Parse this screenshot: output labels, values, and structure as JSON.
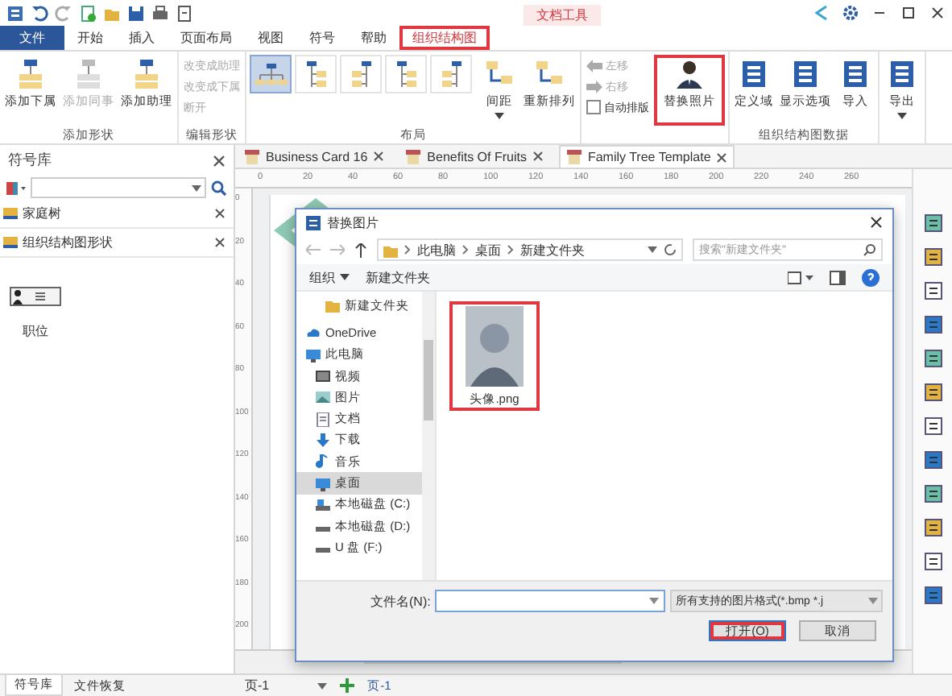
{
  "ribbon": {
    "context_label": "文档工具",
    "tabs": [
      {
        "label": "文件",
        "kind": "file",
        "selected": false,
        "highlighted": false
      },
      {
        "label": "开始",
        "kind": "tab",
        "selected": false,
        "highlighted": false
      },
      {
        "label": "插入",
        "kind": "tab",
        "selected": false,
        "highlighted": false
      },
      {
        "label": "页面布局",
        "kind": "tab",
        "selected": false,
        "highlighted": false
      },
      {
        "label": "视图",
        "kind": "tab",
        "selected": false,
        "highlighted": false
      },
      {
        "label": "符号",
        "kind": "tab",
        "selected": false,
        "highlighted": false
      },
      {
        "label": "帮助",
        "kind": "tab",
        "selected": false,
        "highlighted": false
      },
      {
        "label": "组织结构图",
        "kind": "tab",
        "selected": true,
        "highlighted": true
      }
    ],
    "groups": [
      {
        "label": "添加形状",
        "items": [
          {
            "kind": "large",
            "label": "添加下属",
            "disabled": false,
            "dropdown": false,
            "highlighted": false
          },
          {
            "kind": "large",
            "label": "添加同事",
            "disabled": true,
            "dropdown": false,
            "highlighted": false
          },
          {
            "kind": "large",
            "label": "添加助理",
            "disabled": false,
            "dropdown": false,
            "highlighted": false
          }
        ]
      },
      {
        "label": "编辑形状",
        "items": [
          {
            "kind": "small",
            "label": "改变成助理",
            "disabled": true
          },
          {
            "kind": "small",
            "label": "改变成下属",
            "disabled": true
          },
          {
            "kind": "small",
            "label": "断开",
            "disabled": true
          }
        ]
      },
      {
        "label": "布局",
        "items": [
          {
            "kind": "gallery",
            "options": [
              {
                "selected": true
              },
              {
                "selected": false
              },
              {
                "selected": false
              },
              {
                "selected": false
              },
              {
                "selected": false
              }
            ]
          },
          {
            "kind": "large",
            "label": "间距",
            "disabled": false,
            "dropdown": true,
            "highlighted": false
          },
          {
            "kind": "large",
            "label": "重新排列",
            "disabled": false,
            "dropdown": false,
            "highlighted": false
          }
        ]
      },
      {
        "items": [
          {
            "kind": "small",
            "label": "左移",
            "disabled": true
          },
          {
            "kind": "small",
            "label": "右移",
            "disabled": true
          },
          {
            "kind": "checkbox",
            "label": "自动排版",
            "checked": false
          },
          {
            "kind": "large",
            "label": "替换照片",
            "disabled": false,
            "dropdown": false,
            "highlighted": true
          }
        ]
      },
      {
        "label": "组织结构图数据",
        "items": [
          {
            "kind": "large",
            "label": "定义域",
            "disabled": false,
            "dropdown": false,
            "highlighted": false
          },
          {
            "kind": "large",
            "label": "显示选项",
            "disabled": false,
            "dropdown": false,
            "highlighted": false
          },
          {
            "kind": "large",
            "label": "导入",
            "disabled": false,
            "dropdown": false,
            "highlighted": false
          }
        ]
      },
      {
        "items": [
          {
            "kind": "large",
            "label": "导出",
            "disabled": false,
            "dropdown": true,
            "highlighted": false
          }
        ]
      }
    ]
  },
  "symbol_panel": {
    "title": "符号库",
    "libraries": [
      {
        "label": "家庭树"
      },
      {
        "label": "组织结构图形状"
      }
    ],
    "shape_label": "职位",
    "bottom_tabs": [
      {
        "label": "符号库",
        "selected": true
      },
      {
        "label": "文件恢复",
        "selected": false
      }
    ]
  },
  "document_tabs": [
    {
      "label": "Business Card 16",
      "selected": false
    },
    {
      "label": "Benefits Of Fruits",
      "selected": false
    },
    {
      "label": "Family Tree Template",
      "selected": true
    }
  ],
  "rulers": {
    "horizontal": [
      "0",
      "20",
      "40",
      "60",
      "80",
      "100",
      "120",
      "140",
      "160",
      "180",
      "200",
      "220",
      "240",
      "260"
    ],
    "vertical": [
      "0",
      "20",
      "40",
      "60",
      "80",
      "100",
      "120",
      "140",
      "160",
      "180",
      "200"
    ]
  },
  "dialog": {
    "title": "替换图片",
    "path": [
      "此电脑",
      "桌面",
      "新建文件夹"
    ],
    "search_placeholder": "搜索\"新建文件夹\"",
    "toolbar": {
      "organize": "组织",
      "new_folder": "新建文件夹"
    },
    "nav": [
      {
        "kind": "folder",
        "label": "新建文件夹",
        "selected": false
      },
      {
        "kind": "cloud",
        "label": "OneDrive",
        "selected": false
      },
      {
        "kind": "pc",
        "label": "此电脑",
        "selected": false
      },
      {
        "kind": "video",
        "label": "视频",
        "selected": false
      },
      {
        "kind": "picture",
        "label": "图片",
        "selected": false
      },
      {
        "kind": "document",
        "label": "文档",
        "selected": false
      },
      {
        "kind": "download",
        "label": "下载",
        "selected": false
      },
      {
        "kind": "music",
        "label": "音乐",
        "selected": false
      },
      {
        "kind": "desktop",
        "label": "桌面",
        "selected": true
      },
      {
        "kind": "disk",
        "label": "本地磁盘 (C:)",
        "selected": false
      },
      {
        "kind": "drive",
        "label": "本地磁盘 (D:)",
        "selected": false
      },
      {
        "kind": "drive",
        "label": "U 盘 (F:)",
        "selected": false
      }
    ],
    "files": [
      {
        "name": "头像.png",
        "highlighted": true
      }
    ],
    "filename_label": "文件名(N):",
    "filter": "所有支持的图片格式(*.bmp *.j",
    "buttons": [
      {
        "label": "打开(O)",
        "kind": "primary",
        "highlighted": true
      },
      {
        "label": "取消",
        "kind": "secondary",
        "highlighted": false
      }
    ]
  },
  "status_bar": {
    "page_selector": "页-1",
    "page_tab": "页-1"
  }
}
